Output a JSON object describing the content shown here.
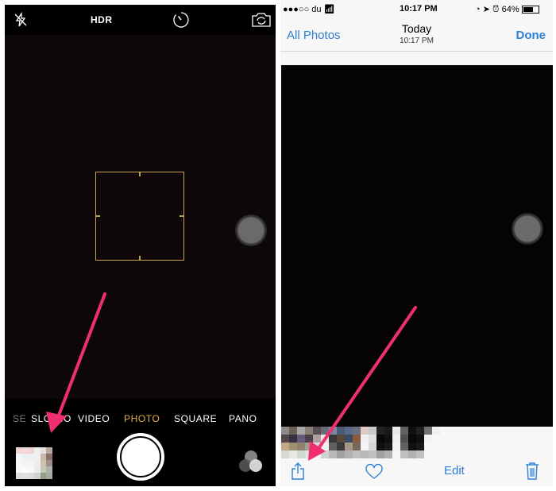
{
  "camera": {
    "top_bar": {
      "flash_icon": "flash-off-icon",
      "hdr_label": "HDR",
      "timer_icon": "timer-icon",
      "flip_icon": "camera-flip-icon"
    },
    "modes": [
      {
        "label": "SE",
        "state": "dim"
      },
      {
        "label": "SLO-MO",
        "state": "normal"
      },
      {
        "label": "VIDEO",
        "state": "normal"
      },
      {
        "label": "PHOTO",
        "state": "active"
      },
      {
        "label": "SQUARE",
        "state": "normal"
      },
      {
        "label": "PANO",
        "state": "normal"
      }
    ],
    "focus_color": "#c9a25a",
    "active_mode_color": "#e5b04a"
  },
  "photos": {
    "status_bar": {
      "carrier": "●●●○○ du",
      "time": "10:17 PM",
      "battery": "64%"
    },
    "nav": {
      "back_label": "All Photos",
      "title": "Today",
      "subtitle": "10:17 PM",
      "done_label": "Done"
    },
    "toolbar": {
      "share_icon": "share-icon",
      "favorite_icon": "heart-icon",
      "edit_label": "Edit",
      "delete_icon": "trash-icon"
    },
    "accent_color": "#2c7fd6"
  },
  "annotation": {
    "arrow_color": "#f0306e"
  }
}
